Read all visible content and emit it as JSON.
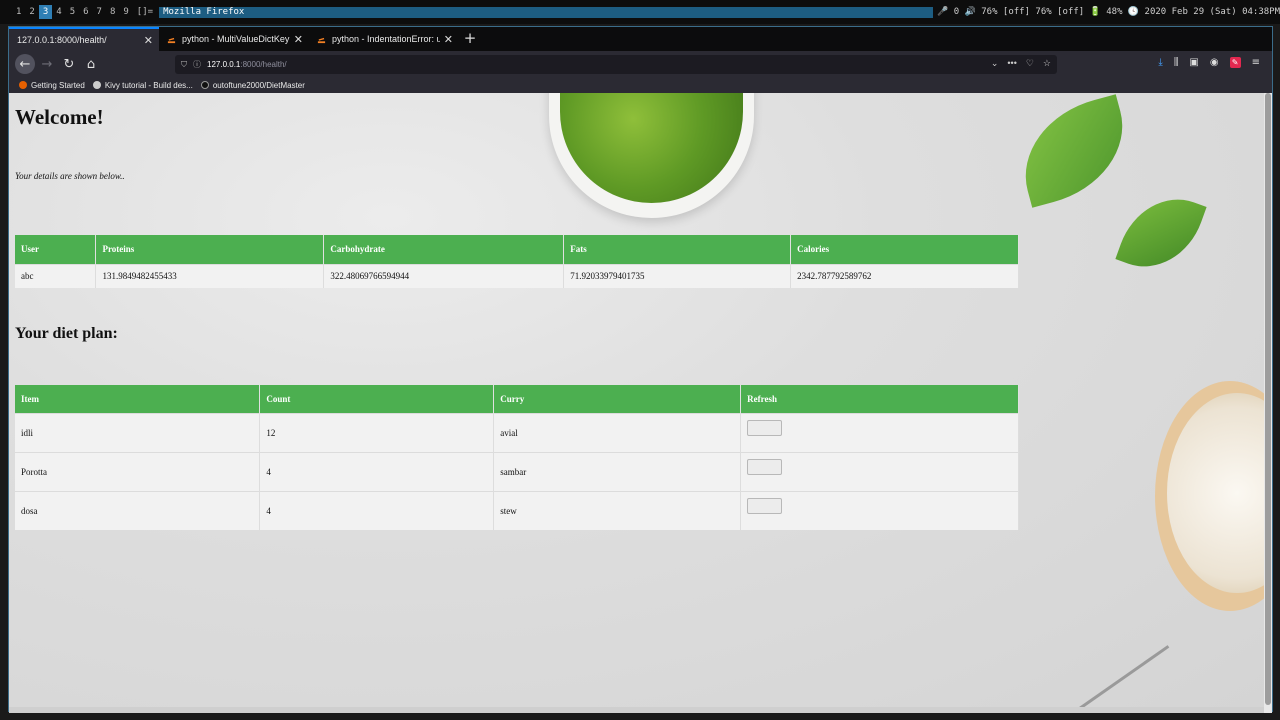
{
  "topbar": {
    "workspaces": [
      "1",
      "2",
      "3",
      "4",
      "5",
      "6",
      "7",
      "8",
      "9"
    ],
    "active_workspace": "3",
    "layout_indicator": "[]=",
    "window_title": "Mozilla Firefox",
    "status_text": "🎤 0 🔊 76% [off] 76% [off] 🔋 48% 🕓 2020 Feb 29 (Sat) 04:38PM"
  },
  "browser": {
    "tabs": [
      {
        "label": "127.0.0.1:8000/health/",
        "active": true
      },
      {
        "label": "python - MultiValueDictKeyE",
        "active": false
      },
      {
        "label": "python - IndentationError: un",
        "active": false
      }
    ],
    "new_tab": "+",
    "url_host": "127.0.0.1",
    "url_path": ":8000/health/",
    "bookmarks": [
      "Getting Started",
      "Kivy tutorial - Build des...",
      "outoftune2000/DietMaster"
    ]
  },
  "page": {
    "title": "Welcome!",
    "subtitle": "Your details are shown below..",
    "user_table": {
      "headers": [
        "User",
        "Proteins",
        "Carbohydrate",
        "Fats",
        "Calories"
      ],
      "rows": [
        [
          "abc",
          "131.9849482455433",
          "322.48069766594944",
          "71.92033979401735",
          "2342.787792589762"
        ]
      ]
    },
    "diet_heading": "Your diet plan:",
    "plan_table": {
      "headers": [
        "Item",
        "Count",
        "Curry",
        "Refresh"
      ],
      "rows": [
        [
          "idli",
          "12",
          "avial"
        ],
        [
          "Porotta",
          "4",
          "sambar"
        ],
        [
          "dosa",
          "4",
          "stew"
        ]
      ]
    }
  },
  "colors": {
    "table_header": "#4caf50",
    "table_row": "#f2f2f2",
    "active_workspace": "#2f7fb5"
  }
}
